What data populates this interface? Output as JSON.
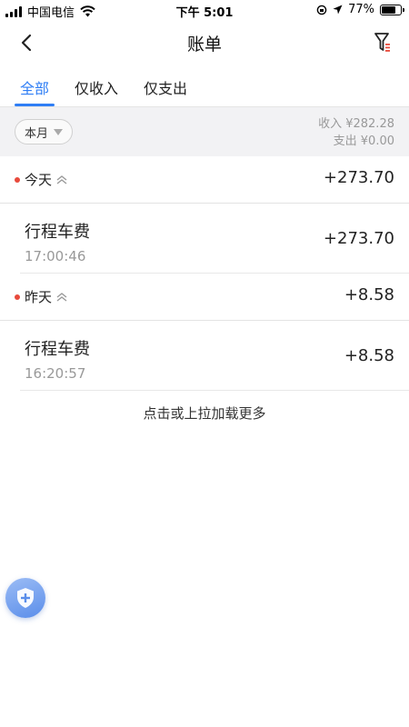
{
  "status_bar": {
    "carrier": "中国电信",
    "time": "下午 5:01",
    "battery_percent": "77%",
    "battery_level": 0.77
  },
  "nav": {
    "title": "账单",
    "back_icon": "chevron-left-icon",
    "filter_icon": "filter-icon"
  },
  "tabs": [
    {
      "label": "全部",
      "active": true
    },
    {
      "label": "仅收入",
      "active": false
    },
    {
      "label": "仅支出",
      "active": false
    }
  ],
  "summary": {
    "month_selected": "本月",
    "income_label": "收入 ¥282.28",
    "expense_label": "支出 ¥0.00"
  },
  "groups": [
    {
      "label": "今天",
      "total": "+273.70",
      "items": [
        {
          "title": "行程车费",
          "time": "17:00:46",
          "amount": "+273.70"
        }
      ]
    },
    {
      "label": "昨天",
      "total": "+8.58",
      "items": [
        {
          "title": "行程车费",
          "time": "16:20:57",
          "amount": "+8.58"
        }
      ]
    }
  ],
  "load_more": "点击或上拉加载更多",
  "colors": {
    "accent": "#2f7ef5",
    "dot_red": "#e84a3c",
    "fab_blue": "#5b8eea"
  }
}
